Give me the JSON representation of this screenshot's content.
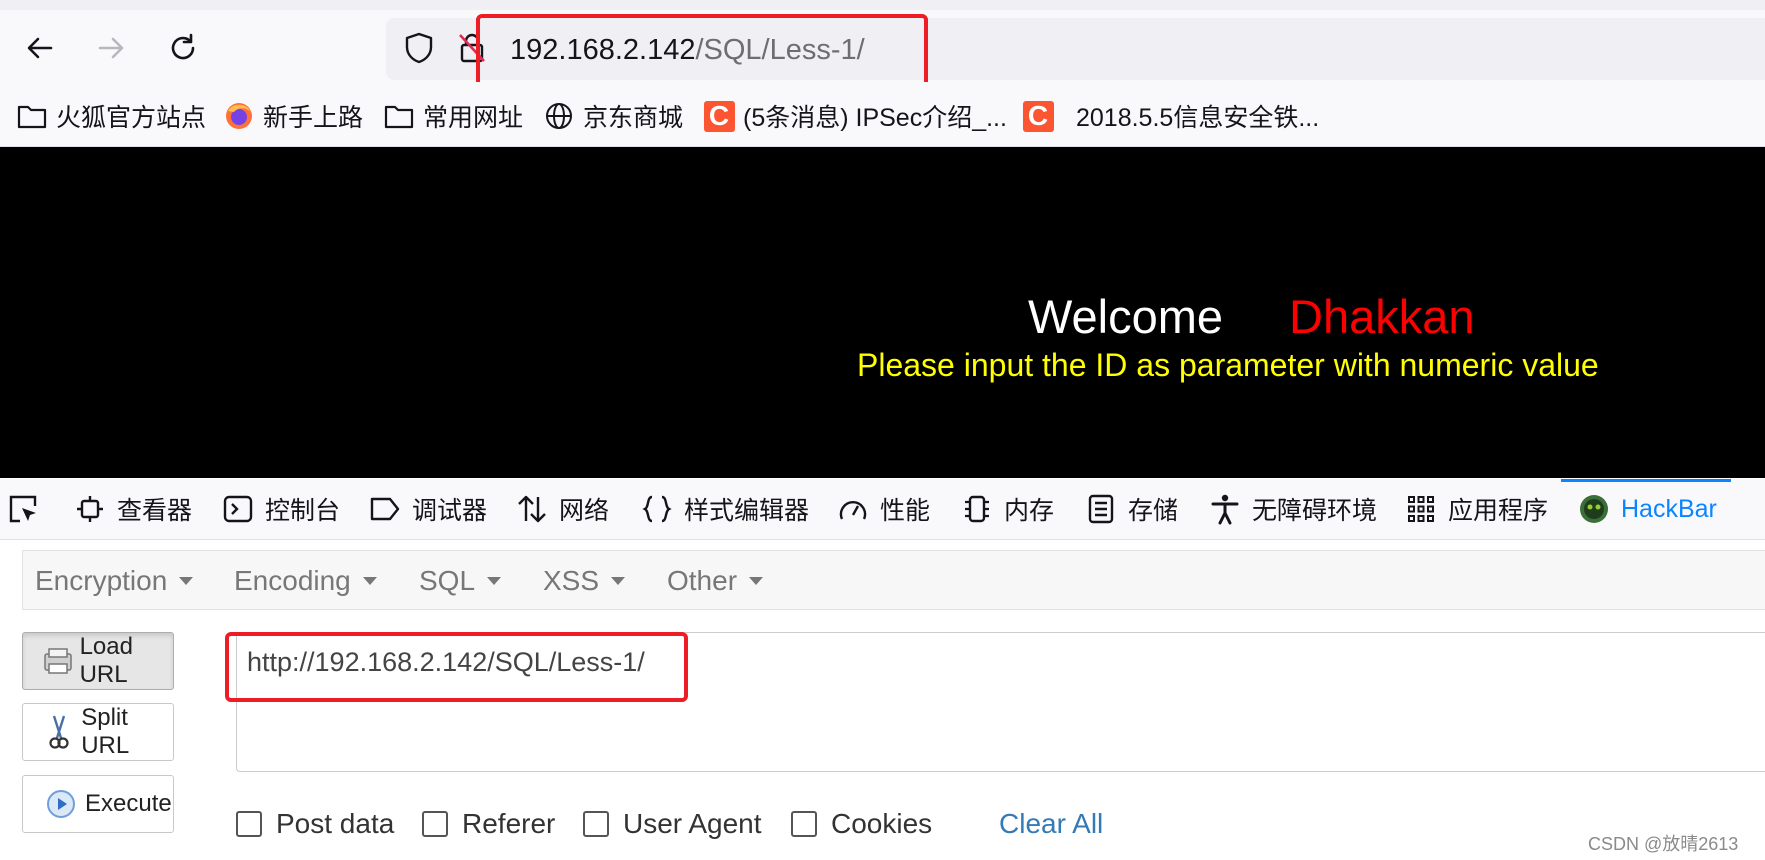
{
  "browser": {
    "url_host": "192.168.2.142",
    "url_path": "/SQL/Less-1/"
  },
  "bookmarks": [
    {
      "label": "火狐官方站点",
      "icon": "folder-icon"
    },
    {
      "label": "新手上路",
      "icon": "firefox-icon"
    },
    {
      "label": "常用网址",
      "icon": "folder-icon"
    },
    {
      "label": "京东商城",
      "icon": "globe-icon"
    },
    {
      "label": "(5条消息) IPSec介绍_...",
      "icon": "csdn-icon",
      "glyph": "C"
    },
    {
      "label": "2018.5.5信息安全铁...",
      "icon": "csdn-icon",
      "glyph": "C"
    }
  ],
  "page": {
    "welcome": "Welcome",
    "name": "Dhakkan",
    "prompt": "Please input the ID as parameter with numeric value",
    "colors": {
      "background": "#000000",
      "welcome": "#ffffff",
      "name": "#ff0000",
      "prompt": "#ffff00"
    }
  },
  "devtools": {
    "tabs": [
      {
        "label": "查看器",
        "icon": "inspector-icon"
      },
      {
        "label": "控制台",
        "icon": "console-icon"
      },
      {
        "label": "调试器",
        "icon": "debugger-icon"
      },
      {
        "label": "网络",
        "icon": "network-icon"
      },
      {
        "label": "样式编辑器",
        "icon": "style-editor-icon"
      },
      {
        "label": "性能",
        "icon": "performance-icon"
      },
      {
        "label": "内存",
        "icon": "memory-icon"
      },
      {
        "label": "存储",
        "icon": "storage-icon"
      },
      {
        "label": "无障碍环境",
        "icon": "accessibility-icon"
      },
      {
        "label": "应用程序",
        "icon": "application-icon"
      },
      {
        "label": "HackBar",
        "icon": "hackbar-icon",
        "active": true
      }
    ],
    "active_color": "#0a84ff"
  },
  "hackbar": {
    "menus": [
      "Encryption",
      "Encoding",
      "SQL",
      "XSS",
      "Other"
    ],
    "buttons": {
      "load": "Load URL",
      "split": "Split URL",
      "execute": "Execute"
    },
    "url_value": "http://192.168.2.142/SQL/Less-1/",
    "checkboxes": [
      {
        "label": "Post data",
        "checked": false
      },
      {
        "label": "Referer",
        "checked": false
      },
      {
        "label": "User Agent",
        "checked": false
      },
      {
        "label": "Cookies",
        "checked": false
      }
    ],
    "clear_all": "Clear All"
  },
  "watermark": "CSDN @放晴2613",
  "highlight_color": "#ee1c25"
}
